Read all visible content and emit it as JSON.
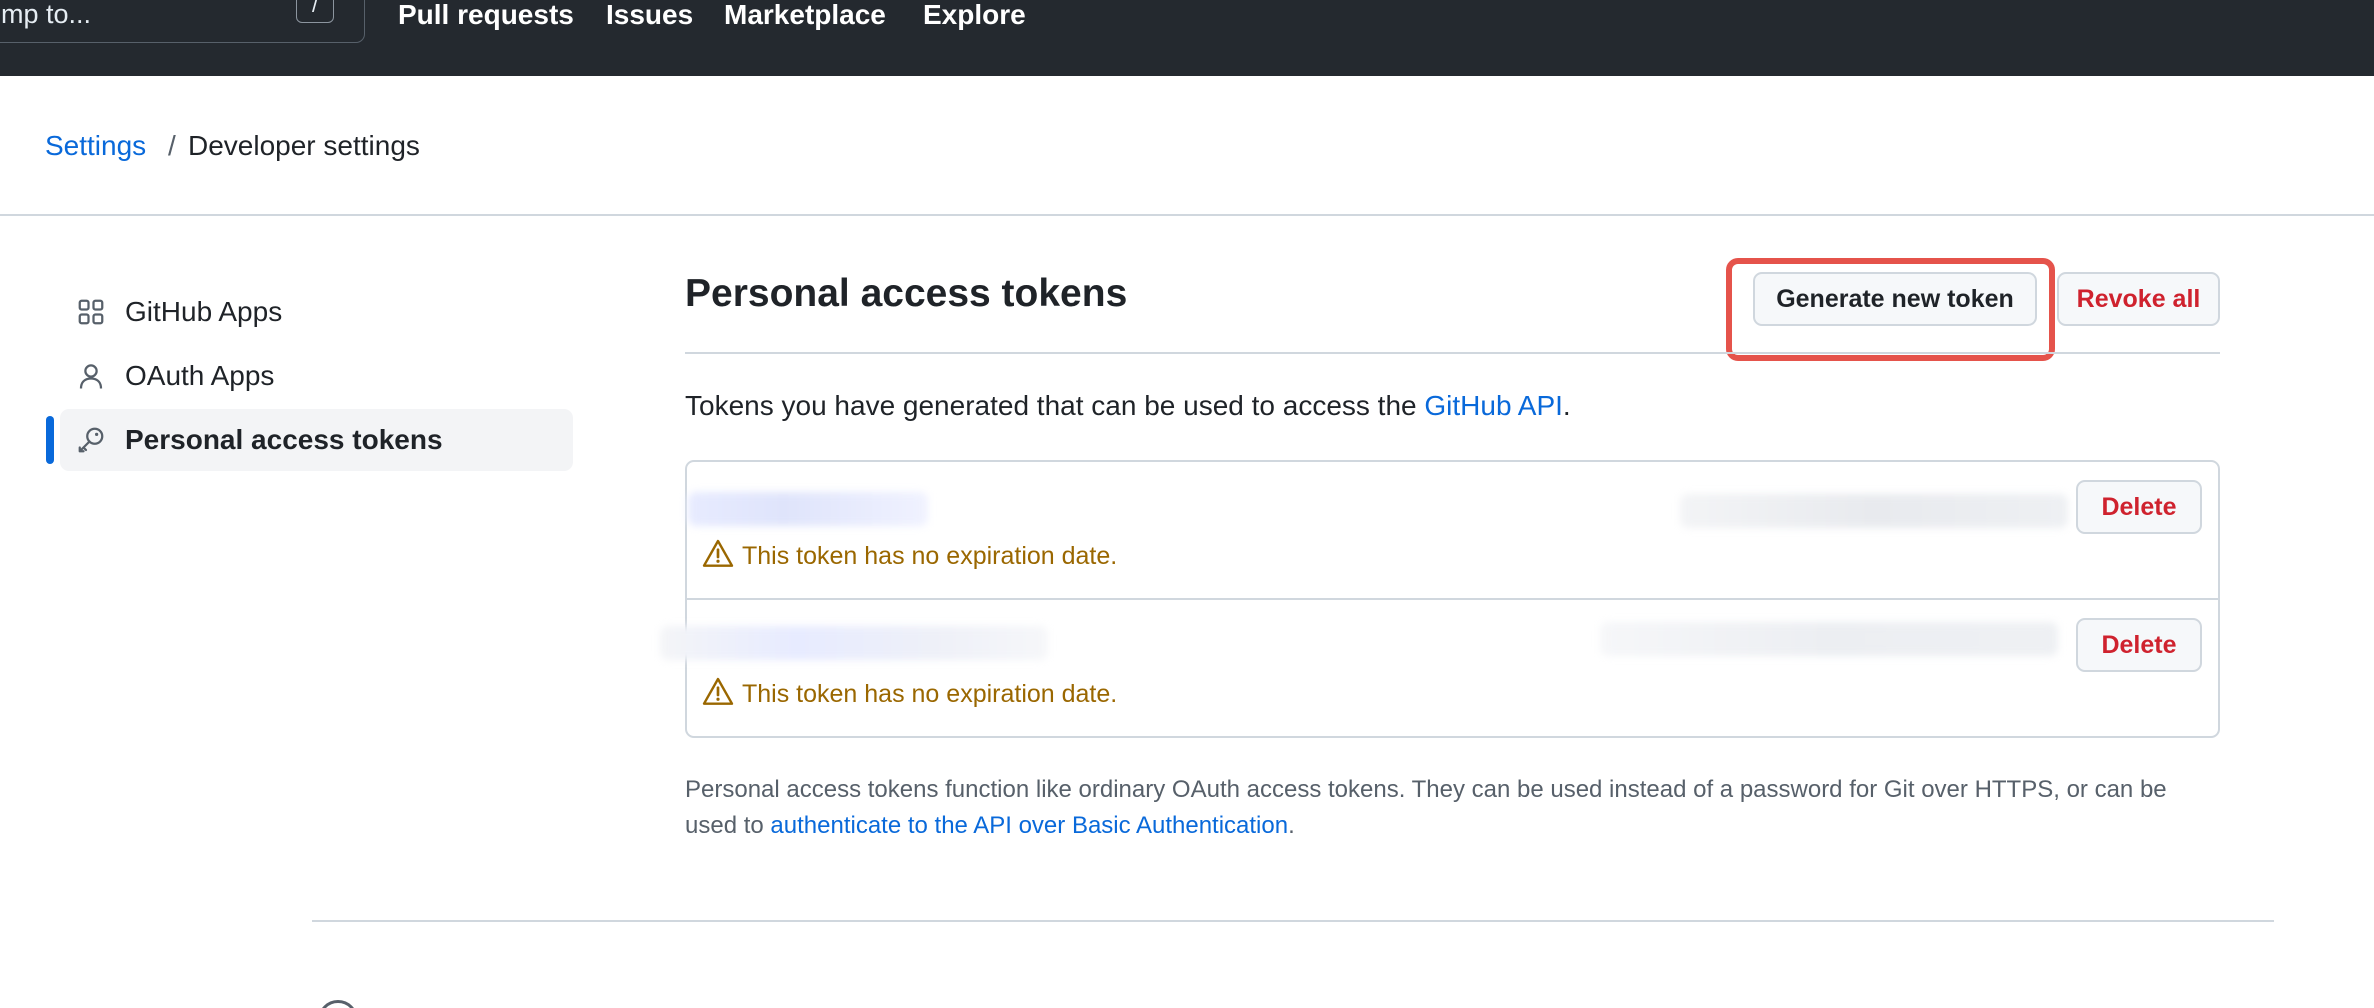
{
  "topnav": {
    "search_placeholder": "Jump to...",
    "search_visible_text": "mp to...",
    "shortcut_key": "/",
    "links": [
      "Pull requests",
      "Issues",
      "Marketplace",
      "Explore"
    ]
  },
  "breadcrumb": {
    "parent": "Settings",
    "separator": "/",
    "current": "Developer settings"
  },
  "sidebar": {
    "items": [
      {
        "label": "GitHub Apps",
        "icon": "apps-grid-icon",
        "active": false
      },
      {
        "label": "OAuth Apps",
        "icon": "person-icon",
        "active": false
      },
      {
        "label": "Personal access tokens",
        "icon": "key-icon",
        "active": true
      }
    ]
  },
  "main": {
    "title": "Personal access tokens",
    "generate_button": "Generate new token",
    "revoke_button": "Revoke all",
    "intro_text": "Tokens you have generated that can be used to access the ",
    "intro_link": "GitHub API",
    "intro_end": "."
  },
  "tokens": [
    {
      "name": "",
      "scopes": "",
      "warning": "This token has no expiration date.",
      "delete_label": "Delete"
    },
    {
      "name": "",
      "scopes": "",
      "warning": "This token has no expiration date.",
      "delete_label": "Delete"
    }
  ],
  "footer": {
    "text_before": "Personal access tokens function like ordinary OAuth access tokens. They can be used instead of a password for Git over HTTPS, or can be used to ",
    "link": "authenticate to the API over Basic Authentication",
    "text_after": "."
  },
  "colors": {
    "nav_bg": "#24292f",
    "link": "#0969da",
    "danger": "#cf222e",
    "warning": "#9a6700",
    "active_indicator": "#0969da",
    "highlight": "#e5534b"
  }
}
